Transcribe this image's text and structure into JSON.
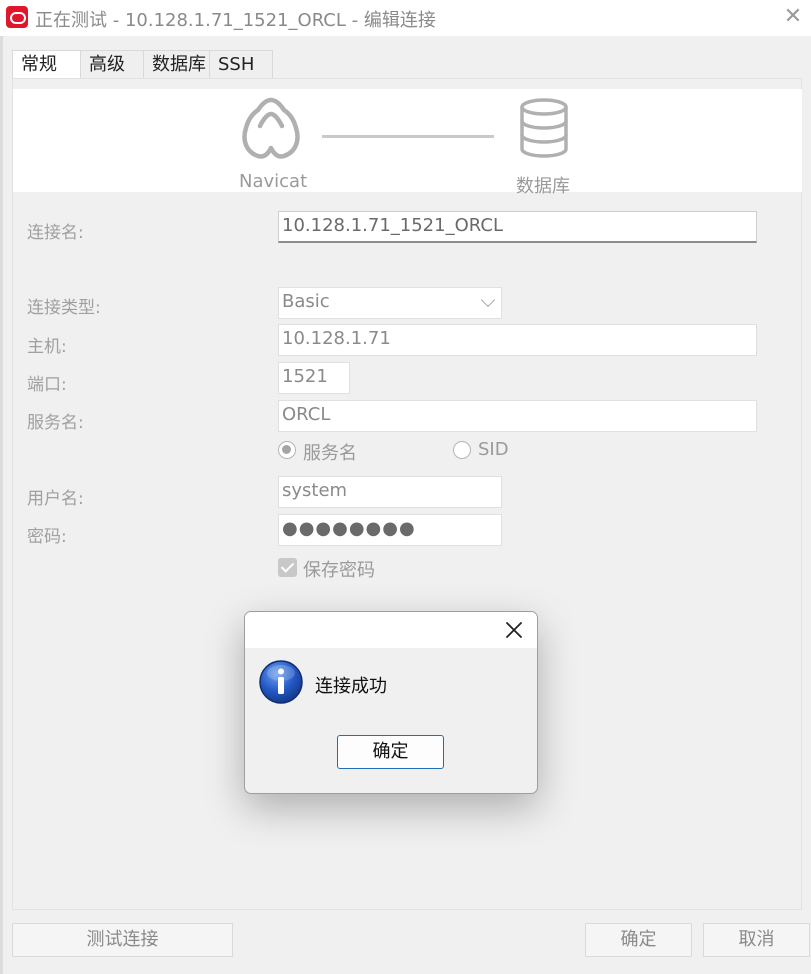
{
  "window": {
    "title": "正在测试 - 10.128.1.71_1521_ORCL - 编辑连接",
    "close_symbol": "✕"
  },
  "tabs": [
    {
      "label": "常规",
      "active": true
    },
    {
      "label": "高级",
      "active": false
    },
    {
      "label": "数据库",
      "active": false
    },
    {
      "label": "SSH",
      "active": false
    }
  ],
  "header": {
    "left_caption": "Navicat",
    "right_caption": "数据库",
    "left_icon": "navicat-logo-icon",
    "right_icon": "database-icon"
  },
  "form": {
    "connection_name_label": "连接名:",
    "connection_name_value": "10.128.1.71_1521_ORCL",
    "connection_type_label": "连接类型:",
    "connection_type_value": "Basic",
    "host_label": "主机:",
    "host_value": "10.128.1.71",
    "port_label": "端口:",
    "port_value": "1521",
    "service_name_label": "服务名:",
    "service_name_value": "ORCL",
    "radio_service_name": "服务名",
    "radio_sid": "SID",
    "username_label": "用户名:",
    "username_value": "system",
    "password_label": "密码:",
    "password_value": "●●●●●●●●",
    "save_password_label": "保存密码"
  },
  "footer": {
    "test_button": "测试连接",
    "ok_button": "确定",
    "cancel_button": "取消"
  },
  "dialog": {
    "message": "连接成功",
    "ok_button": "确定",
    "icon": "info-icon"
  },
  "colors": {
    "brand": "#e0162b",
    "info_blue": "#1d4fa8",
    "focus_border": "#1f6fb2"
  }
}
